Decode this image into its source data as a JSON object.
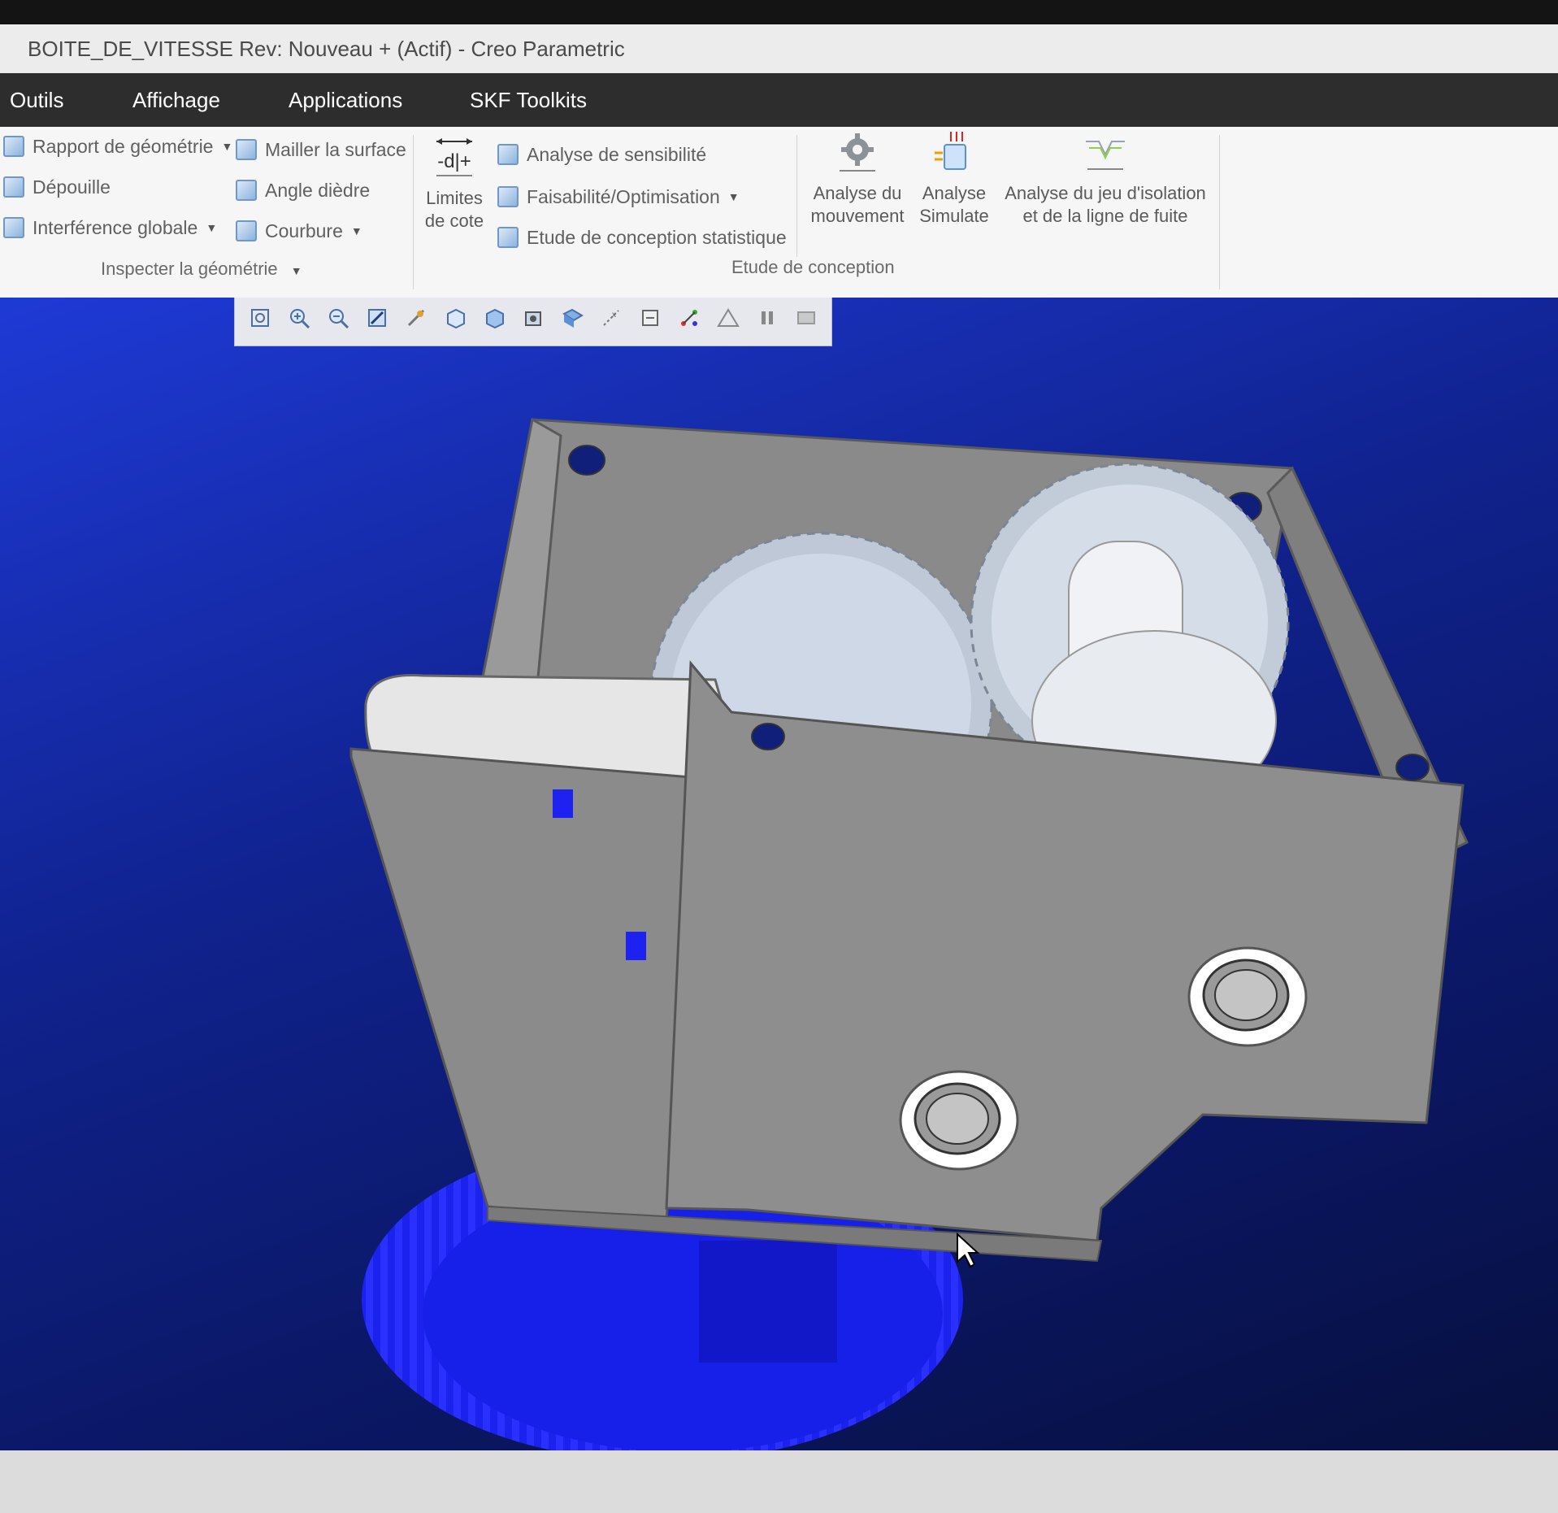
{
  "window": {
    "title": "BOITE_DE_VITESSE Rev: Nouveau + (Actif) - Creo Parametric"
  },
  "menu": {
    "tabs": [
      {
        "label": "Outils"
      },
      {
        "label": "Affichage"
      },
      {
        "label": "Applications"
      },
      {
        "label": "SKF Toolkits"
      }
    ]
  },
  "ribbon": {
    "inspect": {
      "items": [
        {
          "label": "Rapport de géométrie",
          "icon": "geometry-report-icon",
          "has_dropdown": true
        },
        {
          "label": "Dépouille",
          "icon": "draft-icon",
          "has_dropdown": false
        },
        {
          "label": "Interférence globale",
          "icon": "global-interference-icon",
          "has_dropdown": true
        },
        {
          "label": "Mailler la surface",
          "icon": "mesh-surface-icon",
          "has_dropdown": false
        },
        {
          "label": "Angle dièdre",
          "icon": "dihedral-angle-icon",
          "has_dropdown": false
        },
        {
          "label": "Courbure",
          "icon": "curvature-icon",
          "has_dropdown": true
        }
      ],
      "group_label": "Inspecter la géométrie"
    },
    "design": {
      "limits_label_line1": "Limites",
      "limits_label_line2": "de cote",
      "items": [
        {
          "label": "Analyse de sensibilité",
          "icon": "sensitivity-icon",
          "has_dropdown": false
        },
        {
          "label": "Faisabilité/Optimisation",
          "icon": "optimization-icon",
          "has_dropdown": true
        },
        {
          "label": "Etude de conception statistique",
          "icon": "statistical-study-icon",
          "has_dropdown": false
        }
      ],
      "motion_line1": "Analyse du",
      "motion_line2": "mouvement",
      "simulate_line1": "Analyse",
      "simulate_line2": "Simulate",
      "clearance_line1": "Analyse du jeu d'isolation",
      "clearance_line2": "et de la ligne de fuite",
      "group_label": "Etude de conception"
    }
  },
  "view_toolbar": {
    "icons": [
      "refit-icon",
      "zoom-in-icon",
      "zoom-out-icon",
      "repaint-icon",
      "spin-center-icon",
      "display-style-icon",
      "saved-views-icon",
      "view-manager-icon",
      "perspective-icon",
      "datum-display-icon",
      "annotation-display-icon",
      "explode-icon",
      "simulate-display-icon",
      "pause-icon",
      "section-icon"
    ]
  },
  "colors": {
    "titlebar_bg": "#ececec",
    "menubar_bg": "#2d2d2d",
    "ribbon_bg": "#f6f6f6",
    "viewport_bg": "#10228e",
    "housing_gray": "#8a8a8a",
    "gear_light": "#d8e0ec",
    "highlight_blue": "#1d22f0"
  }
}
